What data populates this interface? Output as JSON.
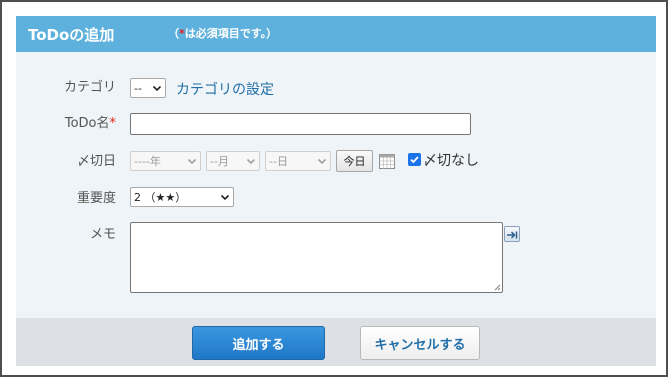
{
  "dialog": {
    "title": "ToDoの追加",
    "required_note_prefix": "（",
    "required_note_star": "*",
    "required_note_suffix": "は必須項目です。）"
  },
  "form": {
    "category": {
      "label": "カテゴリ",
      "selected": "--",
      "settings_link": "カテゴリの設定"
    },
    "todo_name": {
      "label": "ToDo名",
      "required_star": "*",
      "value": ""
    },
    "deadline": {
      "label": "〆切日",
      "year": "----年",
      "month": "--月",
      "day": "--日",
      "today_button": "今日",
      "no_deadline_label": "〆切なし",
      "no_deadline_checked": true
    },
    "priority": {
      "label": "重要度",
      "selected": "2 （★★）"
    },
    "memo": {
      "label": "メモ",
      "value": ""
    }
  },
  "footer": {
    "add_button": "追加する",
    "cancel_button": "キャンセルする"
  },
  "colors": {
    "header_bg": "#5fb1dd",
    "form_bg": "#eef4f7",
    "link": "#1f6ea7",
    "required": "#e02020",
    "primary_button": "#2a86d6"
  }
}
